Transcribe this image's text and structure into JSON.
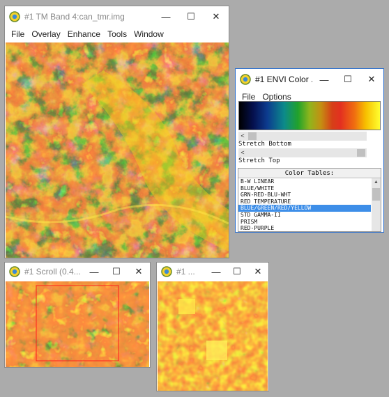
{
  "main_window": {
    "title": "#1 TM Band 4:can_tmr.img",
    "menu": [
      "File",
      "Overlay",
      "Enhance",
      "Tools",
      "Window"
    ],
    "minimize": "—",
    "maximize": "☐",
    "close": "✕"
  },
  "color_window": {
    "title": "#1 ENVI Color ...",
    "menu": [
      "File",
      "Options"
    ],
    "minimize": "—",
    "maximize": "☐",
    "close": "✕",
    "stretch_bottom_label": "Stretch Bottom",
    "stretch_top_label": "Stretch Top",
    "arrow_left": "<",
    "arrow_right": ">",
    "stretch_bottom_value": 0.05,
    "stretch_top_value": 0.97,
    "color_tables_header": "Color Tables:",
    "color_tables": [
      "B-W LINEAR",
      "BLUE/WHITE",
      "GRN-RED-BLU-WHT",
      "RED TEMPERATURE",
      "BLUE/GREEN/RED/YELLOW",
      "STD GAMMA-II",
      "PRISM",
      "RED-PURPLE"
    ],
    "selected_table": "BLUE/GREEN/RED/YELLOW"
  },
  "scroll_window": {
    "title": "#1 Scroll (0.4...",
    "minimize": "—",
    "maximize": "☐",
    "close": "✕"
  },
  "zoom_window": {
    "title": "#1 ...",
    "minimize": "—",
    "maximize": "☐",
    "close": "✕"
  },
  "colors": {
    "title_text": "#888888",
    "desktop": "#ababab",
    "selection": "#3d8ee8"
  }
}
